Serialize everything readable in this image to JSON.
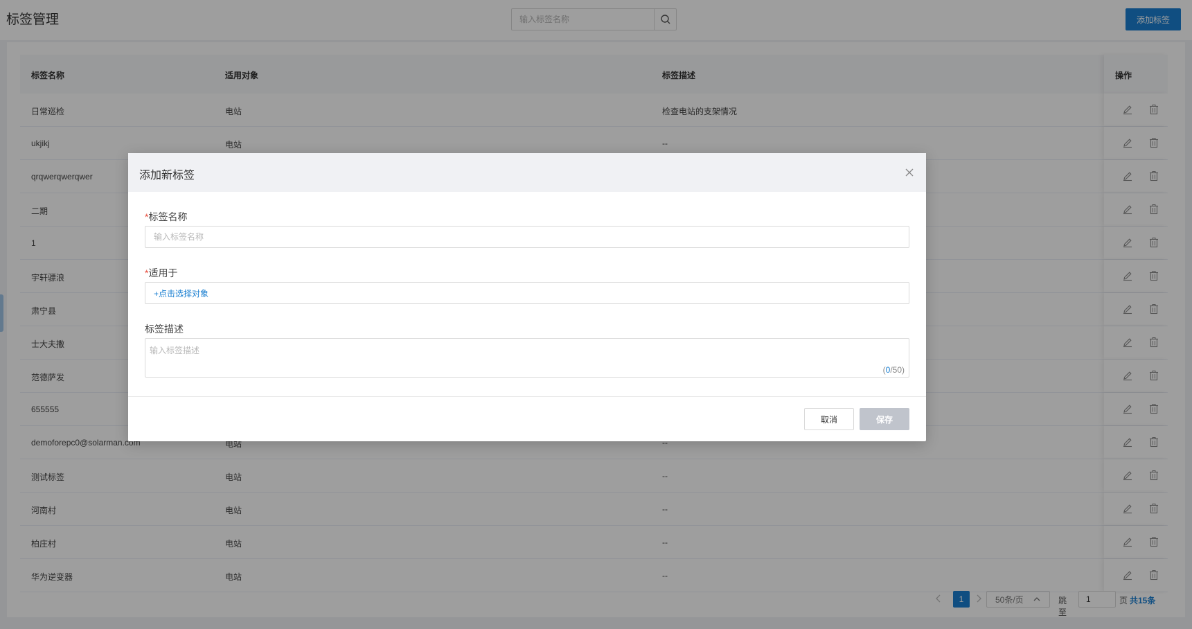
{
  "header": {
    "title": "标签管理",
    "search_placeholder": "输入标签名称",
    "add_button": "添加标签"
  },
  "table": {
    "columns": [
      "标签名称",
      "适用对象",
      "标签描述",
      "操作"
    ],
    "rows": [
      {
        "name": "日常巡检",
        "target": "电站",
        "desc": "检查电站的支架情况"
      },
      {
        "name": "ukjikj",
        "target": "电站",
        "desc": "--"
      },
      {
        "name": "qrqwerqwerqwer",
        "target": "",
        "desc": ""
      },
      {
        "name": "二期",
        "target": "",
        "desc": ""
      },
      {
        "name": "1",
        "target": "",
        "desc": ""
      },
      {
        "name": "宇轩骠浪",
        "target": "",
        "desc": ""
      },
      {
        "name": "肃宁县",
        "target": "",
        "desc": ""
      },
      {
        "name": "士大夫撒",
        "target": "",
        "desc": ""
      },
      {
        "name": "范德萨发",
        "target": "",
        "desc": ""
      },
      {
        "name": "655555",
        "target": "",
        "desc": ""
      },
      {
        "name": "demoforepc0@solarman.com",
        "target": "电站",
        "desc": "--"
      },
      {
        "name": "测试标签",
        "target": "电站",
        "desc": "--"
      },
      {
        "name": "河南村",
        "target": "电站",
        "desc": "--"
      },
      {
        "name": "柏庄村",
        "target": "电站",
        "desc": "--"
      },
      {
        "name": "华为逆变器",
        "target": "电站",
        "desc": "--"
      }
    ]
  },
  "pagination": {
    "current_page": "1",
    "page_size": "50条/页",
    "jump_label": "跳至",
    "jump_value": "1",
    "page_suffix": "页",
    "total": "共15条"
  },
  "modal": {
    "title": "添加新标签",
    "name_label": "标签名称",
    "name_placeholder": "输入标签名称",
    "target_label": "适用于",
    "target_link": "+点击选择对象",
    "desc_label": "标签描述",
    "desc_placeholder": "输入标签描述",
    "char_current": "0",
    "char_max": "/50)",
    "char_open": "(",
    "required_mark": "*",
    "cancel": "取消",
    "save": "保存"
  },
  "colors": {
    "primary": "#1a7fd1",
    "disabled_button": "#c0c4cc",
    "required": "#e74c3c"
  }
}
